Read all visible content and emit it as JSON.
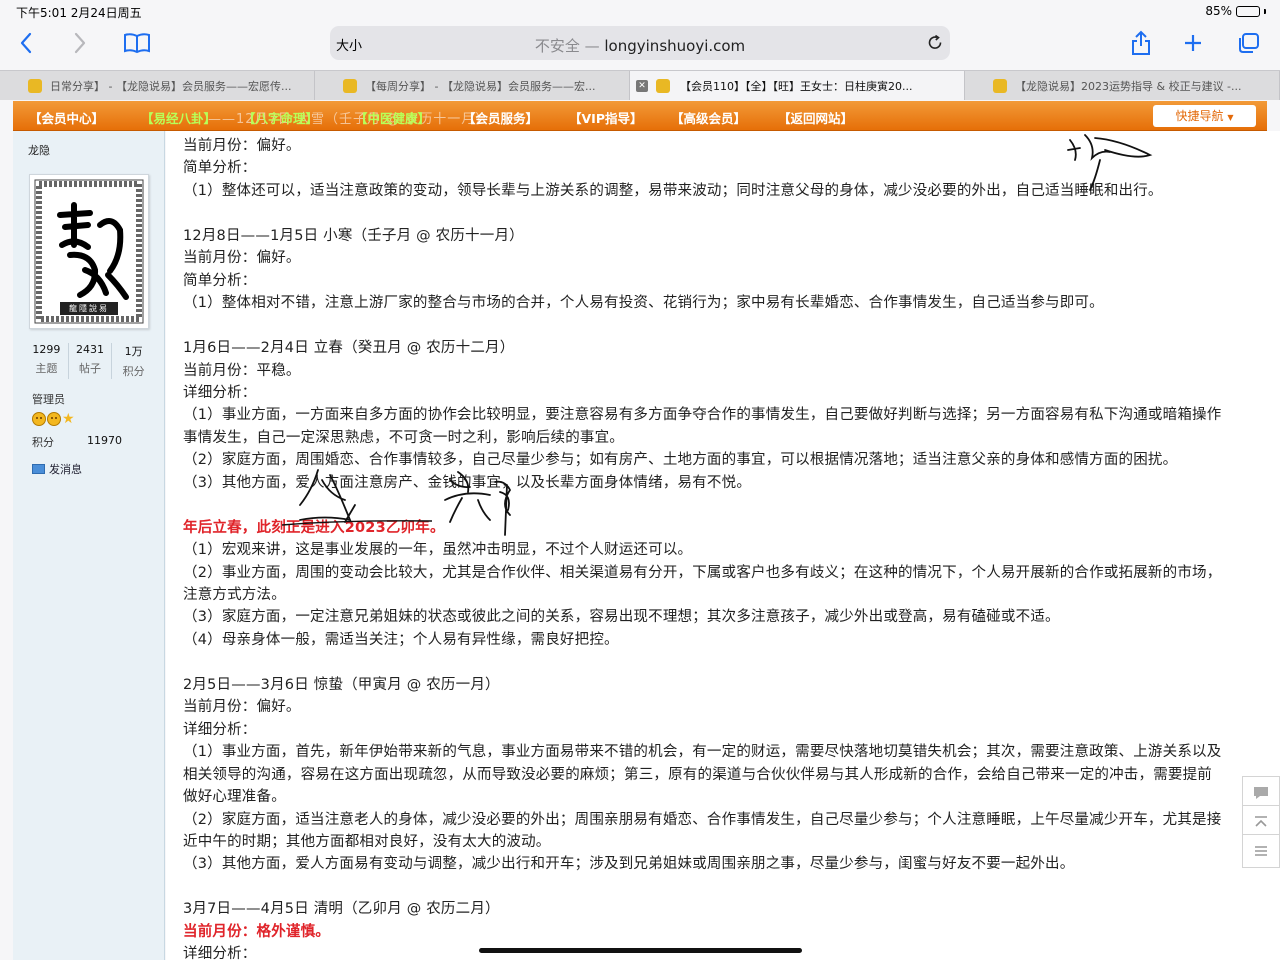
{
  "status_bar": {
    "time": "下午5:01  2月24日周五",
    "battery_pct": "85%",
    "battery_level": 0.85
  },
  "browser": {
    "text_size_button": "大小",
    "address_insecure": "不安全 —",
    "address_domain": "longyinshuoyi.com",
    "icons": [
      "back-icon",
      "forward-icon",
      "bookmarks-icon",
      "reload-icon",
      "share-icon",
      "new-tab-icon",
      "tabs-icon"
    ]
  },
  "tabs": [
    {
      "label": "日常分享】 - 【龙隐说易】会员服务——宏愿传...",
      "active": false
    },
    {
      "label": "【每周分享】 - 【龙隐说易】会员服务——宏...",
      "active": false
    },
    {
      "label": "【会员110】【全】【旺】王女士：日柱庚寅20...",
      "active": true
    },
    {
      "label": "【龙隐说易】2023运势指导 & 校正与建议 -...",
      "active": false
    }
  ],
  "nav": {
    "items": [
      {
        "label": "【会员中心】",
        "green": false
      },
      {
        "label": "【易经八卦】",
        "green": true
      },
      {
        "label": "【八字命理】",
        "green": true
      },
      {
        "label": "【中医健康】",
        "green": true
      },
      {
        "label": "【会员服务】",
        "green": false
      },
      {
        "label": "【VIP指导】",
        "green": false
      },
      {
        "label": "【高级会员】",
        "green": false
      },
      {
        "label": "【返回网站】",
        "green": false
      }
    ],
    "ghost_text": "——12月7日 大雪（壬子月 @ 农历十一月）",
    "quick_nav": "快捷导航"
  },
  "sidebar": {
    "username": "龙隐",
    "stats": [
      {
        "value": "1299",
        "label": "主题"
      },
      {
        "value": "2431",
        "label": "帖子"
      },
      {
        "value": "1万",
        "label": "积分"
      }
    ],
    "role": "管理员",
    "points_label": "积分",
    "points_value": "11970",
    "message_link": "发消息",
    "avatar_seal_text": "龍隱說易"
  },
  "content": {
    "lines": [
      {
        "text": "当前月份：偏好。",
        "red": false
      },
      {
        "text": "简单分析：",
        "red": false
      },
      {
        "text": "（1）整体还可以，适当注意政策的变动，领导长辈与上游关系的调整，易带来波动；同时注意父母的身体，减少没必要的外出，自己适当睡眠和出行。",
        "red": false
      },
      {
        "text": "",
        "red": false
      },
      {
        "text": "12月8日——1月5日 小寒（壬子月 @ 农历十一月）",
        "red": false
      },
      {
        "text": "当前月份：偏好。",
        "red": false
      },
      {
        "text": "简单分析：",
        "red": false
      },
      {
        "text": "（1）整体相对不错，注意上游厂家的整合与市场的合并，个人易有投资、花销行为；家中易有长辈婚恋、合作事情发生，自己适当参与即可。",
        "red": false
      },
      {
        "text": "",
        "red": false
      },
      {
        "text": "1月6日——2月4日 立春（癸丑月 @ 农历十二月）",
        "red": false
      },
      {
        "text": "当前月份：平稳。",
        "red": false
      },
      {
        "text": "详细分析：",
        "red": false
      },
      {
        "text": "（1）事业方面，一方面来自多方面的协作会比较明显，要注意容易有多方面争夺合作的事情发生，自己要做好判断与选择；另一方面容易有私下沟通或暗箱操作",
        "red": false
      },
      {
        "text": "事情发生，自己一定深思熟虑，不可贪一时之利，影响后续的事宜。",
        "red": false
      },
      {
        "text": "（2）家庭方面，周围婚恋、合作事情较多，自己尽量少参与；如有房产、土地方面的事宜，可以根据情况落地；适当注意父亲的身体和感情方面的困扰。",
        "red": false
      },
      {
        "text": "（3）其他方面，爱人方面注意房产、金钱的事宜，以及长辈方面身体情绪，易有不悦。",
        "red": false
      },
      {
        "text": "",
        "red": false
      },
      {
        "text": "年后立春，此刻正是进入2023乙卯年。",
        "red": true
      },
      {
        "text": "（1）宏观来讲，这是事业发展的一年，虽然冲击明显，不过个人财运还可以。",
        "red": false
      },
      {
        "text": "（2）事业方面，周围的变动会比较大，尤其是合作伙伴、相关渠道易有分开，下属或客户也多有歧义；在这种的情况下，个人易开展新的合作或拓展新的市场，",
        "red": false
      },
      {
        "text": "注意方式方法。",
        "red": false
      },
      {
        "text": "（3）家庭方面，一定注意兄弟姐妹的状态或彼此之间的关系，容易出现不理想；其次多注意孩子，减少外出或登高，易有磕碰或不适。",
        "red": false
      },
      {
        "text": "（4）母亲身体一般，需适当关注；个人易有异性缘，需良好把控。",
        "red": false
      },
      {
        "text": "",
        "red": false
      },
      {
        "text": "2月5日——3月6日 惊蛰（甲寅月 @ 农历一月）",
        "red": false
      },
      {
        "text": "当前月份：偏好。",
        "red": false
      },
      {
        "text": "详细分析：",
        "red": false
      },
      {
        "text": "（1）事业方面，首先，新年伊始带来新的气息，事业方面易带来不错的机会，有一定的财运，需要尽快落地切莫错失机会；其次，需要注意政策、上游关系以及",
        "red": false
      },
      {
        "text": "相关领导的沟通，容易在这方面出现疏忽，从而导致没必要的麻烦；第三，原有的渠道与合伙伙伴易与其人形成新的合作，会给自己带来一定的冲击，需要提前",
        "red": false
      },
      {
        "text": "做好心理准备。",
        "red": false
      },
      {
        "text": "（2）家庭方面，适当注意老人的身体，减少没必要的外出；周围亲朋易有婚恋、合作事情发生，自己尽量少参与；个人注意睡眠，上午尽量减少开车，尤其是接",
        "red": false
      },
      {
        "text": "近中午的时期；其他方面都相对良好，没有太大的波动。",
        "red": false
      },
      {
        "text": "（3）其他方面，爱人方面易有变动与调整，减少出行和开车；涉及到兄弟姐妹或周围亲朋之事，尽量少参与，闺蜜与好友不要一起外出。",
        "red": false
      },
      {
        "text": "",
        "red": false
      },
      {
        "text": "3月7日——4月5日 清明（乙卯月 @ 农历二月）",
        "red": false
      },
      {
        "text": "当前月份：格外谨慎。",
        "red": true
      },
      {
        "text": "详细分析：",
        "red": false
      }
    ]
  },
  "colors": {
    "nav_orange": "#ee8420",
    "nav_green_text": "#b8ff58",
    "alert_red": "#e0242a",
    "link_blue": "#1e6ef0"
  }
}
